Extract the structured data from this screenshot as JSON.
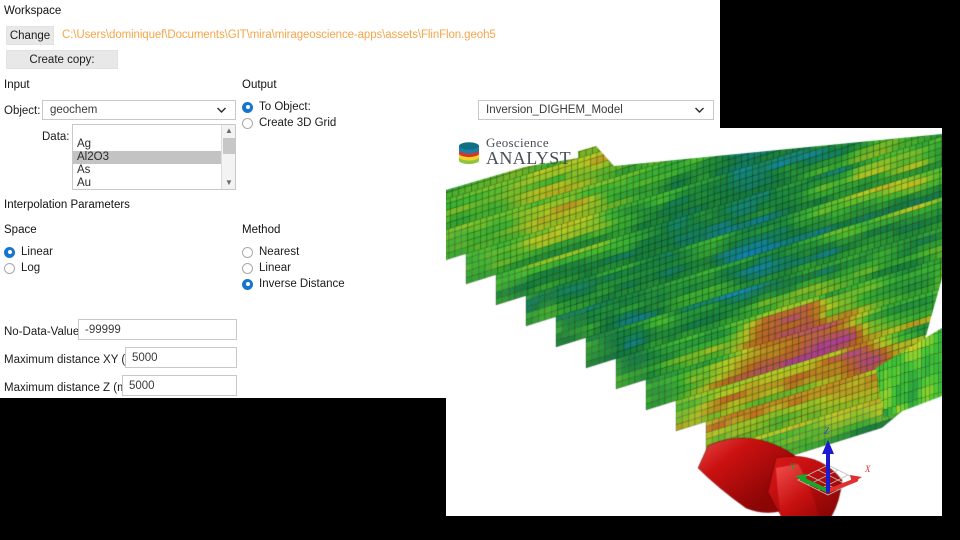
{
  "dialog": {
    "workspace": {
      "label": "Workspace",
      "change_button": "Change",
      "path": "C:\\Users\\dominiquef\\Documents\\GIT\\mira\\mirageoscience-apps\\assets\\FlinFlon.geoh5",
      "create_copy_button": "Create copy:"
    },
    "input": {
      "label": "Input",
      "object_label": "Object:",
      "object_value": "geochem",
      "data_label": "Data:",
      "data_items": [
        "",
        "Ag",
        "Al2O3",
        "As",
        "Au"
      ],
      "data_selected": "Al2O3"
    },
    "output": {
      "label": "Output",
      "options": [
        "To Object:",
        "Create 3D Grid"
      ],
      "selected": "To Object:",
      "object_value": "Inversion_DIGHEM_Model"
    },
    "interpolation": {
      "label": "Interpolation Parameters",
      "space": {
        "label": "Space",
        "options": [
          "Linear",
          "Log"
        ],
        "selected": "Linear"
      },
      "method": {
        "label": "Method",
        "options": [
          "Nearest",
          "Linear",
          "Inverse Distance"
        ],
        "selected": "Inverse Distance"
      },
      "fields": [
        {
          "label": "No-Data-Value",
          "value": "-99999"
        },
        {
          "label": "Maximum distance XY (m)",
          "value": "5000"
        },
        {
          "label": "Maximum distance Z (m)",
          "value": "5000"
        }
      ]
    }
  },
  "viewer": {
    "logo_line1": "Geoscience",
    "logo_line2": "ANALYST",
    "axes": {
      "x": "X",
      "y": "Y",
      "z": "Z"
    }
  },
  "colors": {
    "accent_blue": "#1675d1",
    "path_orange": "#f5a64a",
    "button_grey": "#e8e8e8",
    "selection_grey": "#c3c3c3",
    "axis_x": "#e03030",
    "axis_y": "#14aa28",
    "axis_z": "#1a1ad0",
    "isosurface_red": "#cc1111",
    "background": "#000000"
  }
}
